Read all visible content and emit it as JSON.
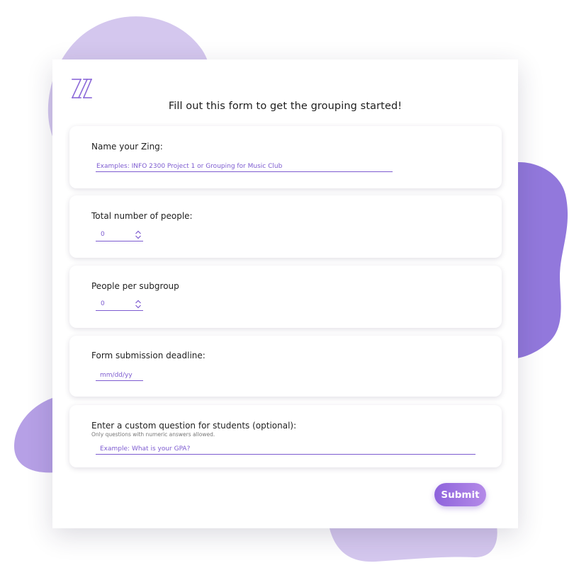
{
  "colors": {
    "accent": "#7d5bd0",
    "blob_light": "#d4c7ee",
    "blob_mid": "#b6a0e6",
    "blob_dark": "#9278dc",
    "button_start": "#8e63dc",
    "button_end": "#b48ae8"
  },
  "logo": {
    "icon": "zing-logo-icon"
  },
  "form": {
    "title": "Fill out this form to get the grouping started!",
    "name": {
      "label": "Name your Zing:",
      "placeholder": "Examples: INFO 2300 Project 1 or Grouping for Music Club",
      "value": ""
    },
    "total_people": {
      "label": "Total number of people:",
      "value": "0",
      "icon": "stepper-arrows-icon"
    },
    "per_subgroup": {
      "label": "People per subgroup",
      "value": "0",
      "icon": "stepper-arrows-icon"
    },
    "deadline": {
      "label": "Form submission deadline:",
      "placeholder": "mm/dd/yy",
      "value": ""
    },
    "custom_question": {
      "label": "Enter a custom question for students (optional):",
      "sublabel": "Only questions with numeric answers allowed.",
      "placeholder": "Example: What is your GPA?",
      "value": ""
    },
    "submit_label": "Submit"
  }
}
